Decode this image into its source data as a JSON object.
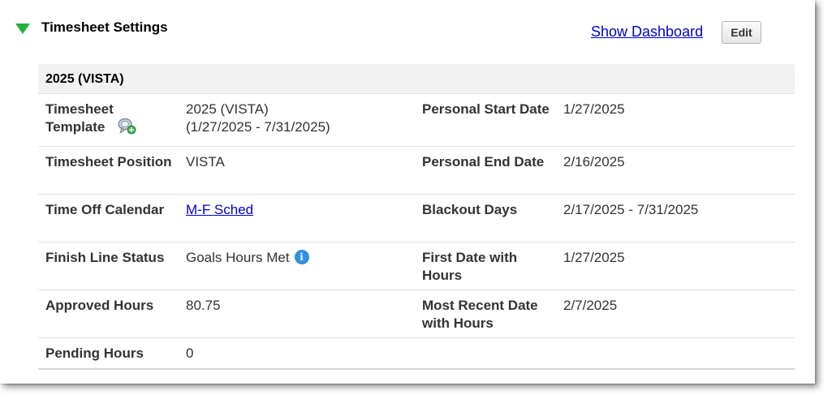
{
  "section": {
    "title": "Timesheet Settings",
    "show_dashboard_label": "Show Dashboard",
    "edit_label": "Edit",
    "toggle_color": "#22b33a"
  },
  "panel": {
    "heading": "2025 (VISTA)",
    "rows": [
      {
        "label1": "Timesheet Template",
        "value1_line1": "2025 (VISTA)",
        "value1_line2": "(1/27/2025 - 7/31/2025)",
        "label2": "Personal Start Date",
        "value2": "1/27/2025",
        "icon": "template-settings-icon"
      },
      {
        "label1": "Timesheet Position",
        "value1": "VISTA",
        "label2": "Personal End Date",
        "value2": "2/16/2025"
      },
      {
        "label1": "Time Off Calendar",
        "value1": "M-F Sched",
        "label2": "Blackout Days",
        "value2": "2/17/2025 - 7/31/2025"
      },
      {
        "label1": "Finish Line Status",
        "value1": "Goals Hours Met",
        "label2": "First Date with Hours",
        "value2": "1/27/2025",
        "icon": "info-icon"
      },
      {
        "label1": "Approved Hours",
        "value1": "80.75",
        "label2": "Most Recent Date with Hours",
        "value2": "2/7/2025"
      },
      {
        "label1": "Pending Hours",
        "value1": "0"
      }
    ]
  },
  "colors": {
    "link": "#0000cc",
    "info": "#2f8fe0",
    "header_bg": "#f2f2f2"
  }
}
